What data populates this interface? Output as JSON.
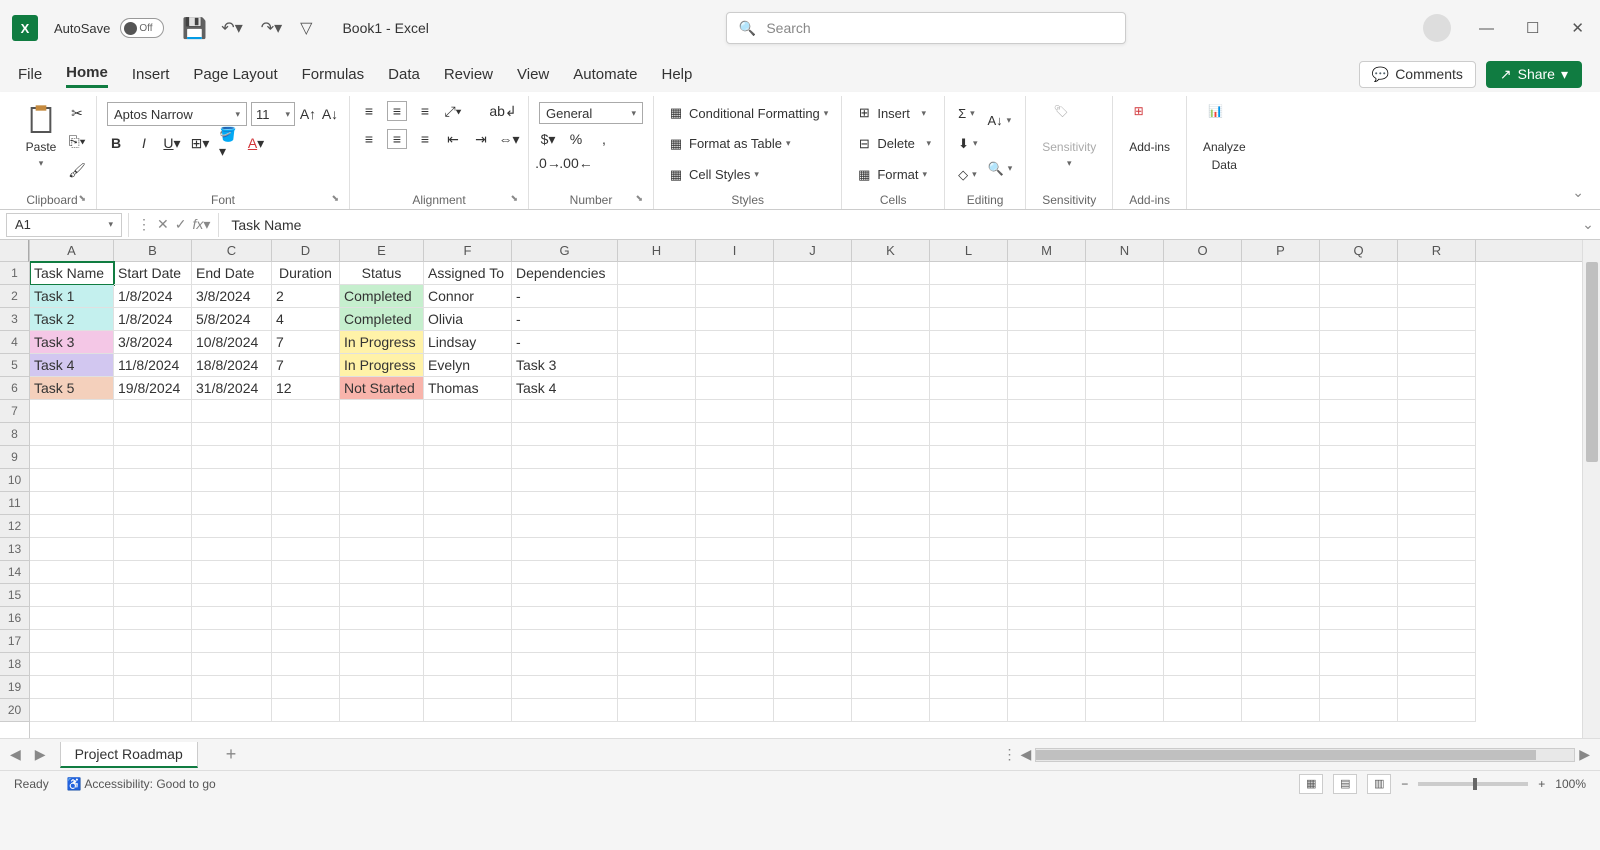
{
  "titlebar": {
    "autosave_label": "AutoSave",
    "autosave_state": "Off",
    "doc_title": "Book1  -  Excel",
    "search_placeholder": "Search"
  },
  "tabs": {
    "file": "File",
    "items": [
      "Home",
      "Insert",
      "Page Layout",
      "Formulas",
      "Data",
      "Review",
      "View",
      "Automate",
      "Help"
    ],
    "active": "Home",
    "comments": "Comments",
    "share": "Share"
  },
  "ribbon": {
    "clipboard": {
      "paste": "Paste",
      "label": "Clipboard"
    },
    "font": {
      "name": "Aptos Narrow",
      "size": "11",
      "label": "Font"
    },
    "alignment": {
      "label": "Alignment"
    },
    "number": {
      "format": "General",
      "label": "Number"
    },
    "styles": {
      "cond": "Conditional Formatting",
      "table": "Format as Table",
      "cell": "Cell Styles",
      "label": "Styles"
    },
    "cells": {
      "insert": "Insert",
      "delete": "Delete",
      "format": "Format",
      "label": "Cells"
    },
    "editing": {
      "label": "Editing"
    },
    "sensitivity": {
      "btn": "Sensitivity",
      "label": "Sensitivity"
    },
    "addins": {
      "btn": "Add-ins",
      "label": "Add-ins"
    },
    "analyze": {
      "btn1": "Analyze",
      "btn2": "Data"
    }
  },
  "formula_bar": {
    "name_box": "A1",
    "formula": "Task Name"
  },
  "grid": {
    "col_letters": [
      "A",
      "B",
      "C",
      "D",
      "E",
      "F",
      "G",
      "H",
      "I",
      "J",
      "K",
      "L",
      "M",
      "N",
      "O",
      "P",
      "Q",
      "R"
    ],
    "row_count": 20,
    "headers": [
      "Task Name",
      "Start Date",
      "End Date",
      "Duration",
      "Status",
      "Assigned To",
      "Dependencies"
    ],
    "rows": [
      {
        "task": "Task 1",
        "start": "1/8/2024",
        "end": "3/8/2024",
        "dur": "2",
        "status": "Completed",
        "assigned": "Connor",
        "dep": "-",
        "taskbg": "bg-task1a",
        "statusbg": "bg-completed"
      },
      {
        "task": "Task 2",
        "start": "1/8/2024",
        "end": "5/8/2024",
        "dur": "4",
        "status": "Completed",
        "assigned": "Olivia",
        "dep": "-",
        "taskbg": "bg-task2",
        "statusbg": "bg-completed"
      },
      {
        "task": "Task 3",
        "start": "3/8/2024",
        "end": "10/8/2024",
        "dur": "7",
        "status": "In Progress",
        "assigned": "Lindsay",
        "dep": "-",
        "taskbg": "bg-task3",
        "statusbg": "bg-inprogress"
      },
      {
        "task": "Task 4",
        "start": "11/8/2024",
        "end": "18/8/2024",
        "dur": "7",
        "status": "In Progress",
        "assigned": "Evelyn",
        "dep": "Task 3",
        "taskbg": "bg-task4",
        "statusbg": "bg-inprogress"
      },
      {
        "task": "Task 5",
        "start": "19/8/2024",
        "end": "31/8/2024",
        "dur": "12",
        "status": "Not Started",
        "assigned": "Thomas",
        "dep": "Task 4",
        "taskbg": "bg-task5",
        "statusbg": "bg-notstarted"
      }
    ]
  },
  "sheet": {
    "name": "Project Roadmap"
  },
  "status": {
    "ready": "Ready",
    "accessibility": "Accessibility: Good to go",
    "zoom": "100%"
  }
}
